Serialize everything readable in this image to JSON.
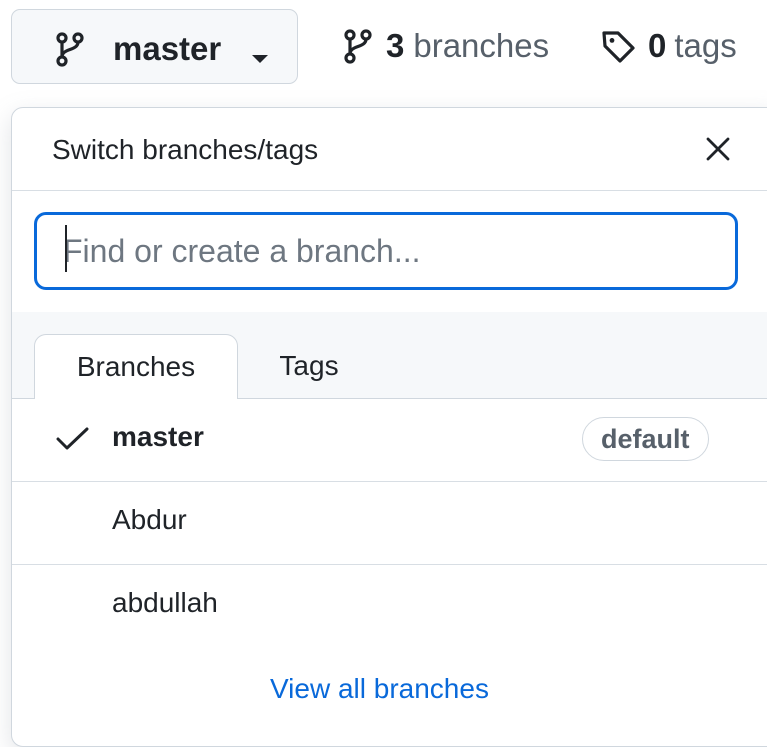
{
  "branch_selector": {
    "current_branch": "master",
    "branch_icon": "git-branch-icon",
    "caret_icon": "triangle-down-icon"
  },
  "branches_link": {
    "count": "3",
    "label": "branches",
    "icon": "git-branch-icon"
  },
  "tags_link": {
    "count": "0",
    "label": "tags",
    "icon": "tag-icon"
  },
  "dropdown": {
    "title": "Switch branches/tags",
    "close_icon": "x-icon",
    "filter": {
      "value": "",
      "placeholder": "Find or create a branch..."
    },
    "tabs": [
      {
        "label": "Branches",
        "selected": true
      },
      {
        "label": "Tags",
        "selected": false
      }
    ],
    "branches": [
      {
        "name": "master",
        "checked": true,
        "badge": "default"
      },
      {
        "name": "Abdur",
        "checked": false,
        "badge": ""
      },
      {
        "name": "abdullah",
        "checked": false,
        "badge": ""
      }
    ],
    "footer_link": "View all branches"
  },
  "colors": {
    "accent": "#0969da",
    "border": "#d0d7de",
    "muted": "#57606a",
    "text": "#1f2328"
  }
}
